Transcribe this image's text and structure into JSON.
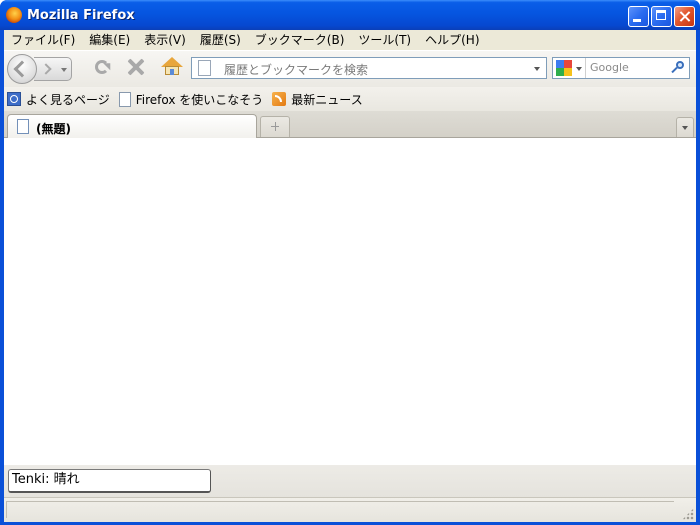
{
  "window": {
    "title": "Mozilla Firefox",
    "icon": "firefox-icon",
    "controls": [
      "minimize-icon",
      "maximize-icon",
      "close-icon"
    ]
  },
  "menu": {
    "items": [
      {
        "label": "ファイル(F)"
      },
      {
        "label": "編集(E)"
      },
      {
        "label": "表示(V)"
      },
      {
        "label": "履歴(S)"
      },
      {
        "label": "ブックマーク(B)"
      },
      {
        "label": "ツール(T)"
      },
      {
        "label": "ヘルプ(H)"
      }
    ]
  },
  "navbar": {
    "icons": [
      "back-icon",
      "forward-icon",
      "history-dropdown-icon",
      "reload-icon",
      "stop-icon",
      "home-icon"
    ],
    "url_placeholder": "履歴とブックマークを検索",
    "search_placeholder": "Google",
    "search_engine_icon": "google-icon"
  },
  "bookmarks": {
    "items": [
      {
        "label": "よく見るページ",
        "icon": "smart-bookmark-icon"
      },
      {
        "label": "Firefox を使いこなそう",
        "icon": "page-icon"
      },
      {
        "label": "最新ニュース",
        "icon": "rss-feed-icon"
      }
    ]
  },
  "tabs": {
    "items": [
      {
        "title": "(無題)",
        "icon": "page-icon",
        "active": true
      }
    ]
  },
  "panel": {
    "tenki_text": "Tenki: 晴れ"
  },
  "colors": {
    "titlebar": "#0655e0",
    "chrome": "#ece9d8",
    "content": "#ffffff"
  }
}
